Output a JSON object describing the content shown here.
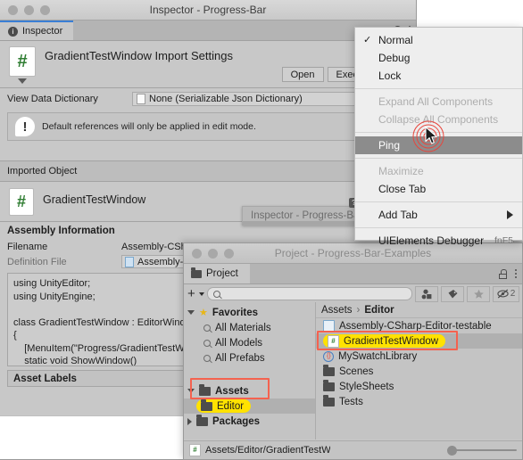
{
  "inspector_window": {
    "title": "Inspector - Progress-Bar",
    "tab_label": "Inspector",
    "import_settings_title": "GradientTestWindow Import Settings",
    "buttons": {
      "open": "Open",
      "execution_order": "Execution Order"
    },
    "view_data_dictionary": {
      "label": "View Data Dictionary",
      "value": "None (Serializable Json Dictionary)"
    },
    "help_message": "Default references will only be applied in edit mode.",
    "imported_object_header": "Imported Object",
    "imported_object_name": "GradientTestWindow",
    "assembly": {
      "title": "Assembly Information",
      "filename_label": "Filename",
      "filename_value": "Assembly-CSharp-Editor-testable.dll",
      "definition_label": "Definition File",
      "definition_value": "Assembly-CSharp-Editor-testable"
    },
    "code": "using UnityEditor;\nusing UnityEngine;\n\nclass GradientTestWindow : EditorWindow\n{\n    [MenuItem(\"Progress/GradientTestWindow\")]\n    static void ShowWindow()",
    "asset_labels_header": "Asset Labels",
    "drag_ghost_label": "Inspector - Progress-Bar"
  },
  "context_menu": {
    "items": [
      {
        "label": "Normal",
        "checked": true,
        "disabled": false,
        "selected": false,
        "accel": "",
        "submenu": false
      },
      {
        "label": "Debug",
        "checked": false,
        "disabled": false,
        "selected": false,
        "accel": "",
        "submenu": false
      },
      {
        "label": "Lock",
        "checked": false,
        "disabled": false,
        "selected": false,
        "accel": "",
        "submenu": false
      },
      {
        "separator": true
      },
      {
        "label": "Expand All Components",
        "checked": false,
        "disabled": true,
        "selected": false,
        "accel": "",
        "submenu": false
      },
      {
        "label": "Collapse All Components",
        "checked": false,
        "disabled": true,
        "selected": false,
        "accel": "",
        "submenu": false
      },
      {
        "separator": true
      },
      {
        "label": "Ping",
        "checked": false,
        "disabled": false,
        "selected": true,
        "accel": "",
        "submenu": false
      },
      {
        "separator": true
      },
      {
        "label": "Maximize",
        "checked": false,
        "disabled": true,
        "selected": false,
        "accel": "",
        "submenu": false
      },
      {
        "label": "Close Tab",
        "checked": false,
        "disabled": false,
        "selected": false,
        "accel": "",
        "submenu": false
      },
      {
        "separator": true
      },
      {
        "label": "Add Tab",
        "checked": false,
        "disabled": false,
        "selected": false,
        "accel": "",
        "submenu": true
      },
      {
        "separator": true
      },
      {
        "label": "UIElements Debugger",
        "checked": false,
        "disabled": false,
        "selected": false,
        "accel": "fnF5",
        "submenu": false
      }
    ]
  },
  "project_window": {
    "title": "Project - Progress-Bar-Examples",
    "tab_label": "Project",
    "search_placeholder": "",
    "hidden_count": "2",
    "tree": [
      {
        "label": "Favorites",
        "kind": "favorites-root",
        "expanded": true,
        "indent": 0,
        "bold": true
      },
      {
        "label": "All Materials",
        "kind": "saved-search",
        "expanded": false,
        "indent": 1,
        "bold": false
      },
      {
        "label": "All Models",
        "kind": "saved-search",
        "expanded": false,
        "indent": 1,
        "bold": false
      },
      {
        "label": "All Prefabs",
        "kind": "saved-search",
        "expanded": false,
        "indent": 1,
        "bold": false
      },
      {
        "label": "Assets",
        "kind": "folder",
        "expanded": true,
        "indent": 0,
        "bold": true
      },
      {
        "label": "Editor",
        "kind": "folder",
        "expanded": false,
        "indent": 1,
        "bold": false,
        "highlighted": true
      },
      {
        "label": "Packages",
        "kind": "folder",
        "expanded": false,
        "indent": 0,
        "bold": true
      }
    ],
    "breadcrumb": [
      "Assets",
      "Editor"
    ],
    "files": [
      {
        "label": "Assembly-CSharp-Editor-testable",
        "icon": "assembly-definition-icon",
        "selected": false,
        "highlighted": false
      },
      {
        "label": "GradientTestWindow",
        "icon": "csharp-script-icon",
        "selected": true,
        "highlighted": true
      },
      {
        "label": "MySwatchLibrary",
        "icon": "swatch-library-icon",
        "selected": false,
        "highlighted": false
      },
      {
        "label": "Scenes",
        "icon": "folder-icon",
        "selected": false,
        "highlighted": false
      },
      {
        "label": "StyleSheets",
        "icon": "folder-icon",
        "selected": false,
        "highlighted": false
      },
      {
        "label": "Tests",
        "icon": "folder-icon",
        "selected": false,
        "highlighted": false
      }
    ],
    "status_path": "Assets/Editor/GradientTestWindow.cs"
  },
  "colors": {
    "accent_tab": "#3a7fd5",
    "highlight_yellow": "#ffe200",
    "annotation_red": "#f4624f",
    "menu_selected": "#8c8c8c",
    "chrome_gray": "#c8c8c8"
  }
}
